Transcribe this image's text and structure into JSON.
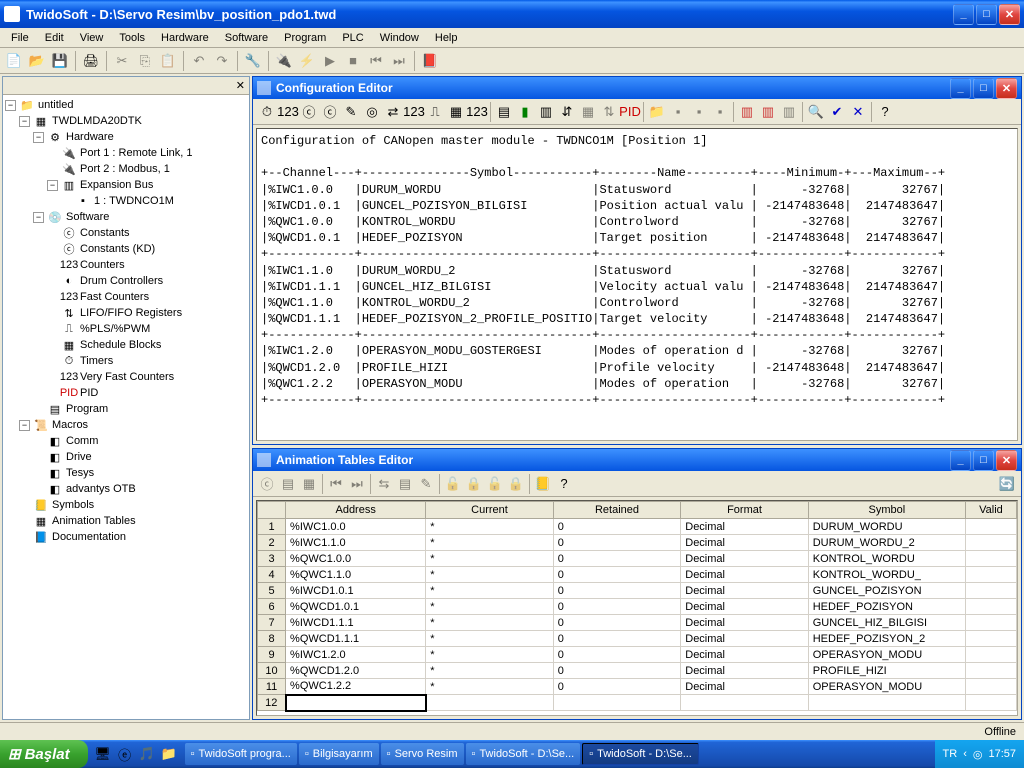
{
  "window": {
    "title": "TwidoSoft - D:\\Servo Resim\\bv_position_pdo1.twd"
  },
  "menu": [
    "File",
    "Edit",
    "View",
    "Tools",
    "Hardware",
    "Software",
    "Program",
    "PLC",
    "Window",
    "Help"
  ],
  "tree": {
    "root": "untitled",
    "plc": "TWDLMDA20DTK",
    "hardware": "Hardware",
    "port1": "Port 1 : Remote Link, 1",
    "port2": "Port 2 : Modbus, 1",
    "expbus": "Expansion Bus",
    "expitem": "1 : TWDNCO1M",
    "software": "Software",
    "sw": [
      "Constants",
      "Constants (KD)",
      "Counters",
      "Drum Controllers",
      "Fast Counters",
      "LIFO/FIFO Registers",
      "%PLS/%PWM",
      "Schedule Blocks",
      "Timers",
      "Very Fast Counters",
      "PID"
    ],
    "program": "Program",
    "macros": "Macros",
    "mac": [
      "Comm",
      "Drive",
      "Tesys",
      "advantys OTB"
    ],
    "symbols": "Symbols",
    "animtables": "Animation Tables",
    "documentation": "Documentation"
  },
  "config": {
    "title": "Configuration Editor",
    "heading": "Configuration of CANopen master module - TWDNCO1M [Position 1]",
    "rows": [
      {
        "ch": "%IWC1.0.0",
        "sym": "DURUM_WORDU",
        "name": "Statusword",
        "min": "-32768",
        "max": "32767"
      },
      {
        "ch": "%IWCD1.0.1",
        "sym": "GUNCEL_POZISYON_BILGISI",
        "name": "Position actual valu",
        "min": "-2147483648",
        "max": "2147483647"
      },
      {
        "ch": "%QWC1.0.0",
        "sym": "KONTROL_WORDU",
        "name": "Controlword",
        "min": "-32768",
        "max": "32767"
      },
      {
        "ch": "%QWCD1.0.1",
        "sym": "HEDEF_POZISYON",
        "name": "Target position",
        "min": "-2147483648",
        "max": "2147483647"
      },
      {
        "ch": "%IWC1.1.0",
        "sym": "DURUM_WORDU_2",
        "name": "Statusword",
        "min": "-32768",
        "max": "32767"
      },
      {
        "ch": "%IWCD1.1.1",
        "sym": "GUNCEL_HIZ_BILGISI",
        "name": "Velocity actual valu",
        "min": "-2147483648",
        "max": "2147483647"
      },
      {
        "ch": "%QWC1.1.0",
        "sym": "KONTROL_WORDU_2",
        "name": "Controlword",
        "min": "-32768",
        "max": "32767"
      },
      {
        "ch": "%QWCD1.1.1",
        "sym": "HEDEF_POZISYON_2_PROFILE_POSITIO",
        "name": "Target velocity",
        "min": "-2147483648",
        "max": "2147483647"
      },
      {
        "ch": "%IWC1.2.0",
        "sym": "OPERASYON_MODU_GOSTERGESI",
        "name": "Modes of operation d",
        "min": "-32768",
        "max": "32767"
      },
      {
        "ch": "%QWCD1.2.0",
        "sym": "PROFILE_HIZI",
        "name": "Profile velocity",
        "min": "-2147483648",
        "max": "2147483647"
      },
      {
        "ch": "%QWC1.2.2",
        "sym": "OPERASYON_MODU",
        "name": "Modes of operation",
        "min": "-32768",
        "max": "32767"
      }
    ]
  },
  "anim": {
    "title": "Animation Tables Editor",
    "headers": [
      "",
      "Address",
      "Current",
      "Retained",
      "Format",
      "Symbol",
      "Valid"
    ],
    "rows": [
      {
        "n": "1",
        "addr": "%IWC1.0.0",
        "cur": "*",
        "ret": "0",
        "fmt": "Decimal",
        "sym": "DURUM_WORDU"
      },
      {
        "n": "2",
        "addr": "%IWC1.1.0",
        "cur": "*",
        "ret": "0",
        "fmt": "Decimal",
        "sym": "DURUM_WORDU_2"
      },
      {
        "n": "3",
        "addr": "%QWC1.0.0",
        "cur": "*",
        "ret": "0",
        "fmt": "Decimal",
        "sym": "KONTROL_WORDU"
      },
      {
        "n": "4",
        "addr": "%QWC1.1.0",
        "cur": "*",
        "ret": "0",
        "fmt": "Decimal",
        "sym": "KONTROL_WORDU_"
      },
      {
        "n": "5",
        "addr": "%IWCD1.0.1",
        "cur": "*",
        "ret": "0",
        "fmt": "Decimal",
        "sym": "GUNCEL_POZISYON"
      },
      {
        "n": "6",
        "addr": "%QWCD1.0.1",
        "cur": "*",
        "ret": "0",
        "fmt": "Decimal",
        "sym": "HEDEF_POZISYON"
      },
      {
        "n": "7",
        "addr": "%IWCD1.1.1",
        "cur": "*",
        "ret": "0",
        "fmt": "Decimal",
        "sym": "GUNCEL_HIZ_BILGISI"
      },
      {
        "n": "8",
        "addr": "%QWCD1.1.1",
        "cur": "*",
        "ret": "0",
        "fmt": "Decimal",
        "sym": "HEDEF_POZISYON_2"
      },
      {
        "n": "9",
        "addr": "%IWC1.2.0",
        "cur": "*",
        "ret": "0",
        "fmt": "Decimal",
        "sym": "OPERASYON_MODU"
      },
      {
        "n": "10",
        "addr": "%QWCD1.2.0",
        "cur": "*",
        "ret": "0",
        "fmt": "Decimal",
        "sym": "PROFILE_HIZI"
      },
      {
        "n": "11",
        "addr": "%QWC1.2.2",
        "cur": "*",
        "ret": "0",
        "fmt": "Decimal",
        "sym": "OPERASYON_MODU"
      },
      {
        "n": "12",
        "addr": "",
        "cur": "",
        "ret": "",
        "fmt": "",
        "sym": ""
      }
    ]
  },
  "status": {
    "offline": "Offline"
  },
  "taskbar": {
    "start": "Başlat",
    "items": [
      {
        "label": "TwidoSoft progra...",
        "active": false
      },
      {
        "label": "Bilgisayarım",
        "active": false
      },
      {
        "label": "Servo Resim",
        "active": false
      },
      {
        "label": "TwidoSoft - D:\\Se...",
        "active": false
      },
      {
        "label": "TwidoSoft - D:\\Se...",
        "active": true
      }
    ],
    "lang": "TR",
    "time": "17:57"
  }
}
